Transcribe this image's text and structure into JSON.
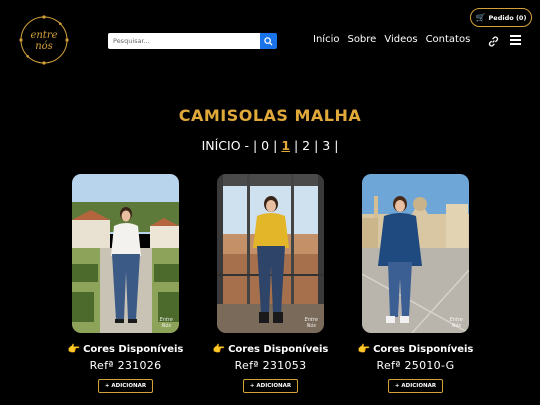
{
  "header": {
    "pedido_label": "Pedido (0)",
    "logo_text_top": "entre",
    "logo_text_bottom": "nós",
    "search_placeholder": "Pesquisar...",
    "nav": [
      "Início",
      "Sobre",
      "Videos",
      "Contatos"
    ]
  },
  "main": {
    "title": "CAMISOLAS MALHA",
    "pager": {
      "prefix": "INÍCIO - | 0 |",
      "current": "1",
      "suffix": "| 2 | 3 |"
    },
    "products": [
      {
        "cores": "Cores Disponíveis",
        "ref": "Refª 231026",
        "add": "+ ADICIONAR",
        "wm1": "Entre",
        "wm2": "Nós"
      },
      {
        "cores": "Cores Disponíveis",
        "ref": "Refª 231053",
        "add": "+ ADICIONAR",
        "wm1": "Entre",
        "wm2": "Nós"
      },
      {
        "cores": "Cores Disponíveis",
        "ref": "Refª 25010-G",
        "add": "+ ADICIONAR",
        "wm1": "Entre",
        "wm2": "Nós"
      }
    ]
  },
  "colors": {
    "accent": "#e0a93a",
    "search_button": "#1a73e8",
    "background": "#000000"
  }
}
